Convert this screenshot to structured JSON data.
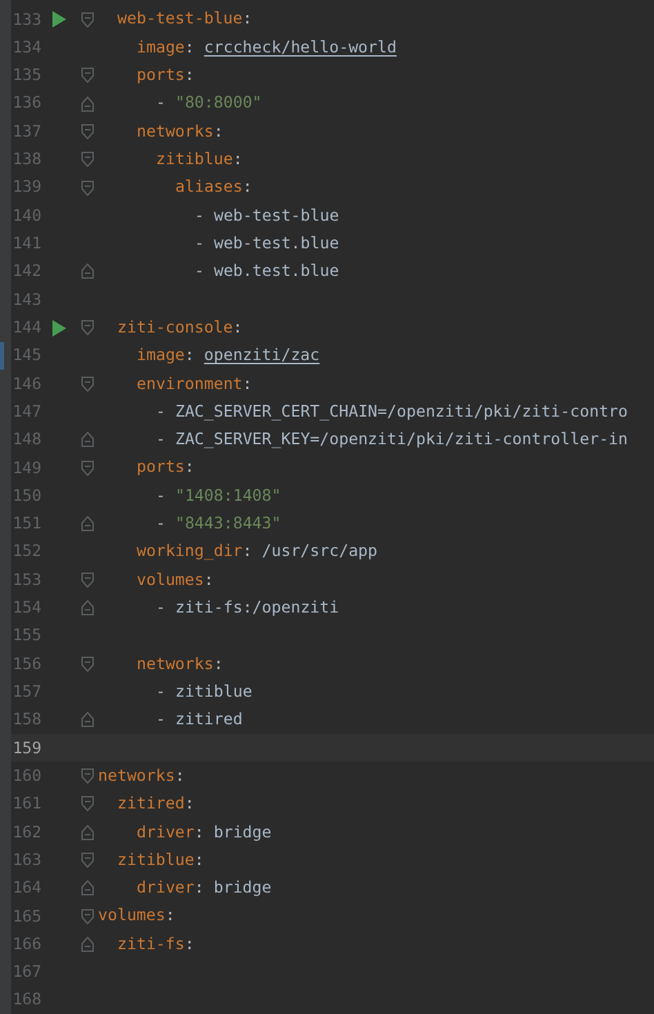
{
  "nested_block": {
    "children": [
      {
        "number": "133",
        "run": true,
        "current": false,
        "changed": false,
        "kind": "fold-start",
        "segments": [
          {
            "kind": "key",
            "text": "web-test-blue"
          },
          {
            "kind": "punct",
            "text": ":"
          }
        ],
        "children": [
          {
            "number": "134",
            "run": false,
            "current": false,
            "changed": false,
            "kind": "line",
            "segments": [
              {
                "kind": "key",
                "text": "image"
              },
              {
                "kind": "punct",
                "text": ":"
              },
              {
                "kind": "link",
                "text": "crccheck/hello-world"
              }
            ]
          },
          {
            "number": "135",
            "run": false,
            "current": false,
            "changed": false,
            "kind": "fold-start",
            "segments": [
              {
                "kind": "key",
                "text": "ports"
              },
              {
                "kind": "punct",
                "text": ":"
              }
            ],
            "children": [
              {
                "number": "136",
                "run": false,
                "current": false,
                "changed": false,
                "kind": "fold-end",
                "segments": [
                  {
                    "kind": "plain",
                    "text": "-"
                  },
                  {
                    "kind": "string",
                    "text": "\"80:8000\""
                  }
                ]
              }
            ]
          },
          {
            "number": "137",
            "run": false,
            "current": false,
            "changed": false,
            "kind": "fold-start",
            "segments": [
              {
                "kind": "key",
                "text": "networks"
              },
              {
                "kind": "punct",
                "text": ":"
              }
            ],
            "children": [
              {
                "number": "138",
                "run": false,
                "current": false,
                "changed": false,
                "kind": "fold-start",
                "segments": [
                  {
                    "kind": "key",
                    "text": "zitiblue"
                  },
                  {
                    "kind": "punct",
                    "text": ":"
                  }
                ],
                "children": [
                  {
                    "number": "139",
                    "run": false,
                    "current": false,
                    "changed": false,
                    "kind": "fold-start",
                    "segments": [
                      {
                        "kind": "key",
                        "text": "aliases"
                      },
                      {
                        "kind": "punct",
                        "text": ":"
                      }
                    ],
                    "children": [
                      {
                        "number": "140",
                        "run": false,
                        "current": false,
                        "changed": false,
                        "kind": "line",
                        "segments": [
                          {
                            "kind": "plain",
                            "text": "- web-test-blue"
                          }
                        ]
                      },
                      {
                        "number": "141",
                        "run": false,
                        "current": false,
                        "changed": false,
                        "kind": "line",
                        "segments": [
                          {
                            "kind": "plain",
                            "text": "- web-test.blue"
                          }
                        ]
                      },
                      {
                        "number": "142",
                        "run": false,
                        "current": false,
                        "changed": false,
                        "kind": "fold-end",
                        "segments": [
                          {
                            "kind": "plain",
                            "text": "- web.test.blue"
                          }
                        ]
                      }
                    ]
                  }
                ]
              }
            ]
          }
        ]
      },
      {
        "number": "143",
        "run": false,
        "current": false,
        "changed": false,
        "kind": "line"
      },
      {
        "number": "144",
        "run": true,
        "current": false,
        "changed": false,
        "kind": "fold-start",
        "segments": [
          {
            "kind": "key",
            "text": "ziti-console"
          },
          {
            "kind": "punct",
            "text": ":"
          }
        ],
        "children": [
          {
            "number": "145",
            "run": false,
            "current": false,
            "changed": true,
            "kind": "line",
            "segments": [
              {
                "kind": "key",
                "text": "image"
              },
              {
                "kind": "punct",
                "text": ":"
              },
              {
                "kind": "link",
                "text": "openziti/zac"
              }
            ]
          },
          {
            "number": "146",
            "run": false,
            "current": false,
            "changed": false,
            "kind": "fold-start",
            "segments": [
              {
                "kind": "key",
                "text": "environment"
              },
              {
                "kind": "punct",
                "text": ":"
              }
            ],
            "children": [
              {
                "number": "147",
                "run": false,
                "current": false,
                "changed": false,
                "kind": "line",
                "segments": [
                  {
                    "kind": "plain",
                    "text": "- ZAC_SERVER_CERT_CHAIN=/openziti/pki/ziti-contro"
                  }
                ]
              },
              {
                "number": "148",
                "run": false,
                "current": false,
                "changed": false,
                "kind": "fold-end",
                "segments": [
                  {
                    "kind": "plain",
                    "text": "- ZAC_SERVER_KEY=/openziti/pki/ziti-controller-in"
                  }
                ]
              }
            ]
          },
          {
            "number": "149",
            "run": false,
            "current": false,
            "changed": false,
            "kind": "fold-start",
            "segments": [
              {
                "kind": "key",
                "text": "ports"
              },
              {
                "kind": "punct",
                "text": ":"
              }
            ],
            "children": [
              {
                "number": "150",
                "run": false,
                "current": false,
                "changed": false,
                "kind": "line",
                "segments": [
                  {
                    "kind": "plain",
                    "text": "-"
                  },
                  {
                    "kind": "string",
                    "text": "\"1408:1408\""
                  }
                ]
              },
              {
                "number": "151",
                "run": false,
                "current": false,
                "changed": false,
                "kind": "fold-end",
                "segments": [
                  {
                    "kind": "plain",
                    "text": "-"
                  },
                  {
                    "kind": "string",
                    "text": "\"8443:8443\""
                  }
                ]
              }
            ]
          },
          {
            "number": "152",
            "run": false,
            "current": false,
            "changed": false,
            "kind": "line",
            "segments": [
              {
                "kind": "key",
                "text": "working_dir"
              },
              {
                "kind": "punct",
                "text": ":"
              },
              {
                "kind": "plain",
                "text": "/usr/src/app"
              }
            ]
          },
          {
            "number": "153",
            "run": false,
            "current": false,
            "changed": false,
            "kind": "fold-start",
            "segments": [
              {
                "kind": "key",
                "text": "volumes"
              },
              {
                "kind": "punct",
                "text": ":"
              }
            ],
            "children": [
              {
                "number": "154",
                "run": false,
                "current": false,
                "changed": false,
                "kind": "fold-end",
                "segments": [
                  {
                    "kind": "plain",
                    "text": "- ziti-fs:/openziti"
                  }
                ]
              }
            ]
          },
          {
            "number": "155",
            "run": false,
            "current": false,
            "changed": false,
            "kind": "line"
          },
          {
            "number": "156",
            "run": false,
            "current": false,
            "changed": false,
            "kind": "fold-start",
            "segments": [
              {
                "kind": "key",
                "text": "networks"
              },
              {
                "kind": "punct",
                "text": ":"
              }
            ],
            "children": [
              {
                "number": "157",
                "run": false,
                "current": false,
                "changed": false,
                "kind": "line",
                "segments": [
                  {
                    "kind": "plain",
                    "text": "- zitiblue"
                  }
                ]
              },
              {
                "number": "158",
                "run": false,
                "current": false,
                "changed": false,
                "kind": "fold-end",
                "segments": [
                  {
                    "kind": "plain",
                    "text": "- zitired"
                  }
                ]
              }
            ]
          }
        ]
      },
      {
        "number": "159",
        "run": false,
        "current": true,
        "changed": false,
        "kind": "line"
      }
    ]
  },
  "lines": [
    {
      "number": "160",
      "run": false,
      "current": false,
      "changed": false,
      "kind": "fold-start",
      "segments": [
        {
          "kind": "key",
          "text": "networks"
        },
        {
          "kind": "punct",
          "text": ":"
        }
      ],
      "children": [
        {
          "number": "161",
          "run": false,
          "current": false,
          "changed": false,
          "kind": "fold-start",
          "segments": [
            {
              "kind": "key",
              "text": "zitired"
            },
            {
              "kind": "punct",
              "text": ":"
            }
          ],
          "children": [
            {
              "number": "162",
              "run": false,
              "current": false,
              "changed": false,
              "kind": "fold-end",
              "segments": [
                {
                  "kind": "key",
                  "text": "driver"
                },
                {
                  "kind": "punct",
                  "text": ":"
                },
                {
                  "kind": "plain",
                  "text": "bridge"
                }
              ]
            }
          ]
        },
        {
          "number": "163",
          "run": false,
          "current": false,
          "changed": false,
          "kind": "fold-start",
          "segments": [
            {
              "kind": "key",
              "text": "zitiblue"
            },
            {
              "kind": "punct",
              "text": ":"
            }
          ],
          "children": [
            {
              "number": "164",
              "run": false,
              "current": false,
              "changed": false,
              "kind": "fold-end",
              "segments": [
                {
                  "kind": "key",
                  "text": "driver"
                },
                {
                  "kind": "punct",
                  "text": ":"
                },
                {
                  "kind": "plain",
                  "text": "bridge"
                }
              ]
            }
          ]
        }
      ]
    },
    {
      "number": "165",
      "run": false,
      "current": false,
      "changed": false,
      "kind": "fold-start",
      "segments": [
        {
          "kind": "key",
          "text": "volumes"
        },
        {
          "kind": "punct",
          "text": ":"
        }
      ],
      "children": [
        {
          "number": "166",
          "run": false,
          "current": false,
          "changed": false,
          "kind": "fold-end",
          "segments": [
            {
              "kind": "key",
              "text": "ziti-fs"
            },
            {
              "kind": "punct",
              "text": ":"
            }
          ]
        }
      ]
    },
    {
      "number": "167",
      "run": false,
      "current": false,
      "changed": false,
      "kind": "line"
    },
    {
      "number": "168",
      "run": false,
      "current": false,
      "changed": false,
      "kind": "line"
    }
  ]
}
